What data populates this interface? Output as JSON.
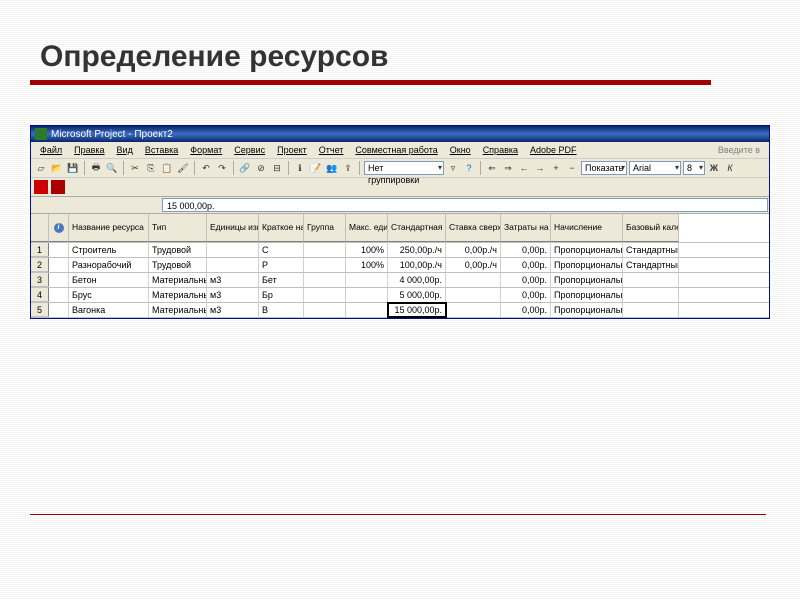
{
  "slide": {
    "title": "Определение ресурсов"
  },
  "titlebar": {
    "text": "Microsoft Project - Проект2"
  },
  "menubar": {
    "items": [
      "Файл",
      "Правка",
      "Вид",
      "Вставка",
      "Формат",
      "Сервис",
      "Проект",
      "Отчет",
      "Совместная работа",
      "Окно",
      "Справка",
      "Adobe PDF"
    ],
    "right": "Введите в"
  },
  "toolbar": {
    "grouping": "Нет группировки",
    "show": "Показать",
    "font": "Arial",
    "size": "8",
    "bold": "Ж",
    "italic": "К"
  },
  "edit_field": "15 000,00р.",
  "table": {
    "headers": {
      "info": "i",
      "name": "Название ресурса",
      "type": "Тип",
      "unit": "Единицы измерения материалов",
      "short": "Краткое название",
      "group": "Группа",
      "max": "Макс. единиц",
      "std": "Стандартная ставка",
      "over": "Ставка сверхурочных",
      "cost": "Затраты на использ.",
      "accr": "Начисление",
      "cal": "Базовый календарь"
    },
    "rows": [
      {
        "n": "1",
        "name": "Строитель",
        "type": "Трудовой",
        "unit": "",
        "short": "С",
        "group": "",
        "max": "100%",
        "std": "250,00р./ч",
        "over": "0,00р./ч",
        "cost": "0,00р.",
        "accr": "Пропорциональное",
        "cal": "Стандартный"
      },
      {
        "n": "2",
        "name": "Разнорабочий",
        "type": "Трудовой",
        "unit": "",
        "short": "Р",
        "group": "",
        "max": "100%",
        "std": "100,00р./ч",
        "over": "0,00р./ч",
        "cost": "0,00р.",
        "accr": "Пропорциональное",
        "cal": "Стандартный"
      },
      {
        "n": "3",
        "name": "Бетон",
        "type": "Материальный",
        "unit": "м3",
        "short": "Бет",
        "group": "",
        "max": "",
        "std": "4 000,00р.",
        "over": "",
        "cost": "0,00р.",
        "accr": "Пропорциональное",
        "cal": ""
      },
      {
        "n": "4",
        "name": "Брус",
        "type": "Материальный",
        "unit": "м3",
        "short": "Бр",
        "group": "",
        "max": "",
        "std": "5 000,00р.",
        "over": "",
        "cost": "0,00р.",
        "accr": "Пропорциональное",
        "cal": ""
      },
      {
        "n": "5",
        "name": "Вагонка",
        "type": "Материальный",
        "unit": "м3",
        "short": "В",
        "group": "",
        "max": "",
        "std": "15 000,00р.",
        "over": "",
        "cost": "0,00р.",
        "accr": "Пропорциональное",
        "cal": ""
      }
    ]
  }
}
